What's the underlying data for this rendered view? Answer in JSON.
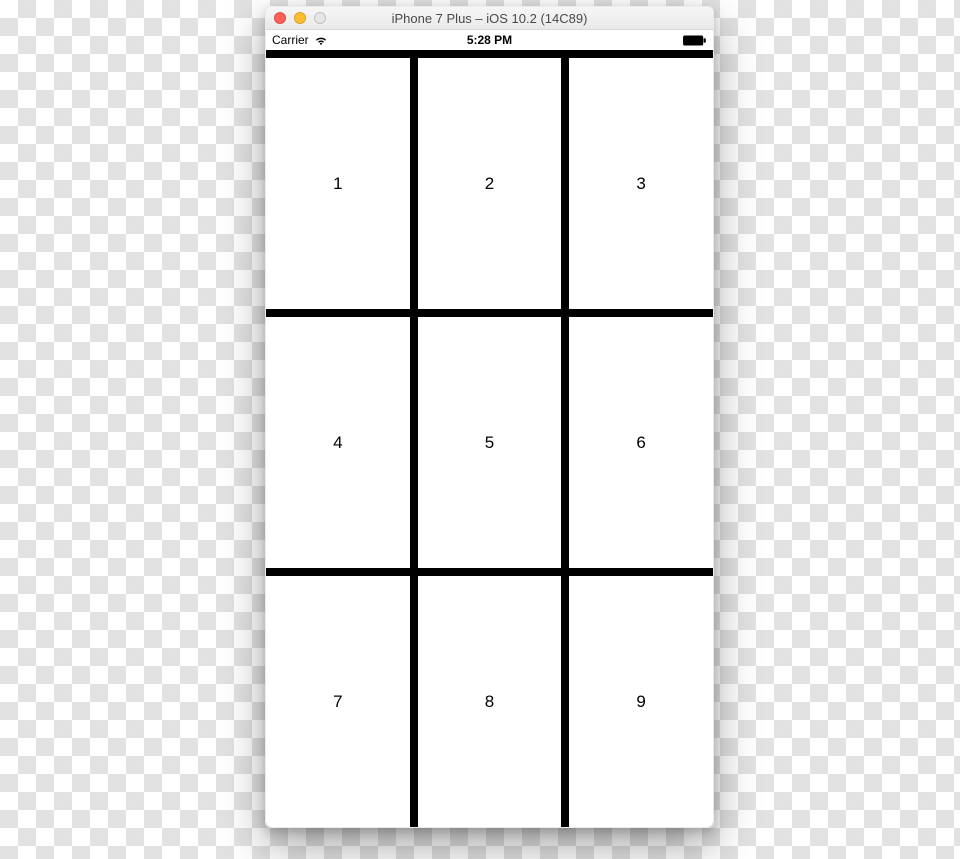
{
  "window": {
    "title": "iPhone 7 Plus – iOS 10.2 (14C89)"
  },
  "status_bar": {
    "carrier": "Carrier",
    "time": "5:28 PM"
  },
  "grid": {
    "cells": [
      "1",
      "2",
      "3",
      "4",
      "5",
      "6",
      "7",
      "8",
      "9"
    ]
  }
}
